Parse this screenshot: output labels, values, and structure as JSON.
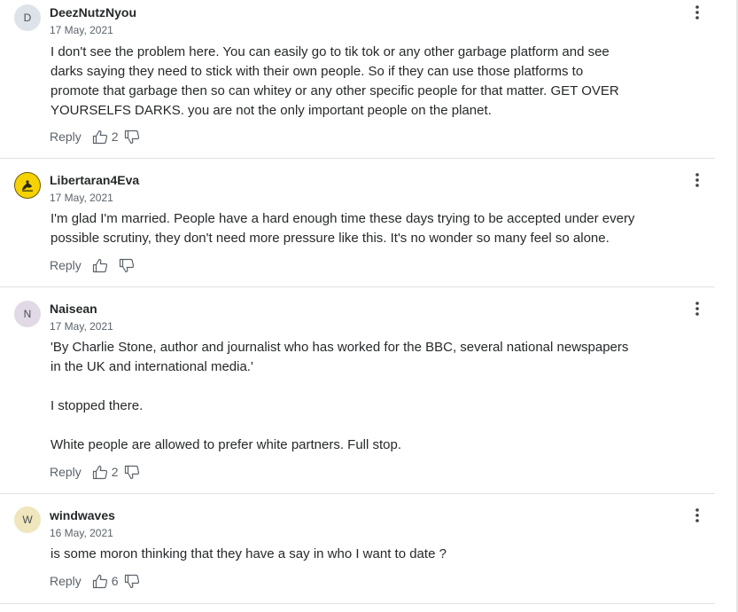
{
  "comments": [
    {
      "avatar_letter": "D",
      "avatar_color": "#dde3e8",
      "username": "DeezNutzNyou",
      "date": "17 May, 2021",
      "lines": [
        "I don't see the problem here. You can easily go to tik tok or any other garbage platform and see",
        "darks saying they need to stick with their own people.  So if they can use those platforms to",
        "promote that garbage then so can whitey or any other specific people for that matter. GET OVER",
        "YOURSELFS DARKS. you are not the only important people on the planet."
      ],
      "reply_label": "Reply",
      "like_count": "2"
    },
    {
      "avatar_icon": "flag-avatar-icon",
      "avatar_color": "#f6d200",
      "username": "Libertaran4Eva",
      "date": "17 May, 2021",
      "lines": [
        "I'm glad I'm married.  People have a hard enough time these days trying to be accepted under every",
        "possible scrutiny, they don't need more pressure like this.  It's no wonder so many feel so alone."
      ],
      "reply_label": "Reply",
      "like_count": ""
    },
    {
      "avatar_letter": "N",
      "avatar_color": "#e2d9e6",
      "username": "Naisean",
      "date": "17 May, 2021",
      "lines": [
        "'By Charlie Stone, author and journalist who has worked for the BBC, several national newspapers",
        "in the UK and international media.'",
        "I stopped there.",
        "White people are allowed to prefer white partners.  Full stop."
      ],
      "reply_label": "Reply",
      "like_count": "2"
    },
    {
      "avatar_letter": "W",
      "avatar_color": "#efe6bd",
      "username": "windwaves",
      "date": "16 May, 2021",
      "lines": [
        "is some moron thinking that they have a say in who I want to date ?"
      ],
      "reply_label": "Reply",
      "like_count": "6"
    }
  ],
  "icons": {
    "like": "thumbs-up-icon",
    "dislike": "thumbs-down-icon",
    "menu": "kebab-menu-icon"
  }
}
